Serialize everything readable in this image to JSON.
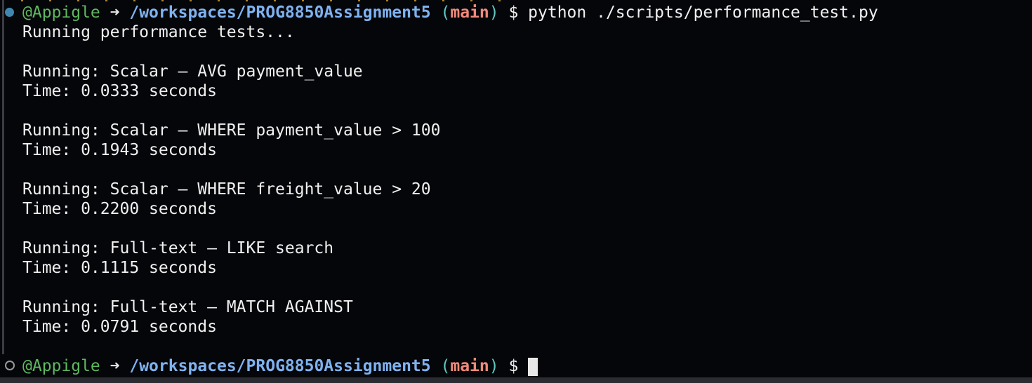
{
  "prompt": {
    "user": "@Appigle",
    "arrow": "➜",
    "path": "/workspaces/PROG8850Assignment5",
    "branch_open": "(",
    "branch": "main",
    "branch_close": ")",
    "symbol": "$"
  },
  "command": "python ./scripts/performance_test.py",
  "output": [
    "Running performance tests...",
    "",
    "Running: Scalar – AVG payment_value",
    "Time: 0.0333 seconds",
    "",
    "Running: Scalar – WHERE payment_value > 100",
    "Time: 0.1943 seconds",
    "",
    "Running: Scalar – WHERE freight_value > 20",
    "Time: 0.2200 seconds",
    "",
    "Running: Full-text – LIKE search",
    "Time: 0.1115 seconds",
    "",
    "Running: Full-text – MATCH AGAINST",
    "Time: 0.0791 seconds"
  ],
  "colors": {
    "background": "#05060a",
    "user": "#5fb85f",
    "path": "#7fb2f0",
    "branch": "#f08a7a",
    "paren": "#5fc7c0"
  }
}
